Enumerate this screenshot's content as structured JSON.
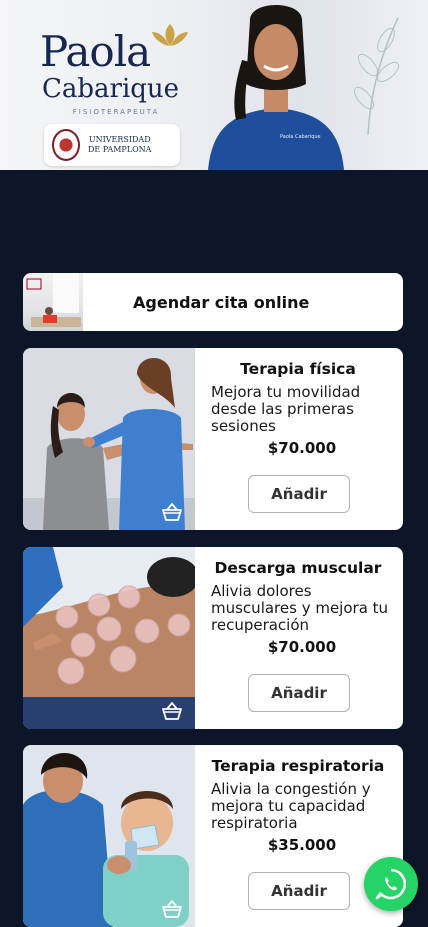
{
  "header": {
    "brand_first": "Paola",
    "brand_last": "Cabarique",
    "brand_tagline": "FISIOTERAPEUTA",
    "university_line1": "UNIVERSIDAD",
    "university_line2": "DE PAMPLONA",
    "uniform_text": "Paola Cabarique Fisioterapeuta"
  },
  "appointment": {
    "label": "Agendar cita online"
  },
  "services": [
    {
      "title": "Terapia física",
      "description": "Mejora tu movilidad desde las primeras sesiones",
      "price": "$70.000",
      "button": "Añadir"
    },
    {
      "title": "Descarga muscular",
      "description": "Alivia dolores musculares y mejora tu recuperación",
      "price": "$70.000",
      "button": "Añadir"
    },
    {
      "title": "Terapia respiratoria",
      "description": "Alivia la congestión y mejora tu capacidad respiratoria",
      "price": "$35.000",
      "button": "Añadir"
    }
  ],
  "colors": {
    "background": "#0d1629",
    "brand_navy": "#16284f",
    "whatsapp": "#25d366"
  },
  "icons": {
    "cart": "basket-icon",
    "chat": "whatsapp-icon"
  }
}
